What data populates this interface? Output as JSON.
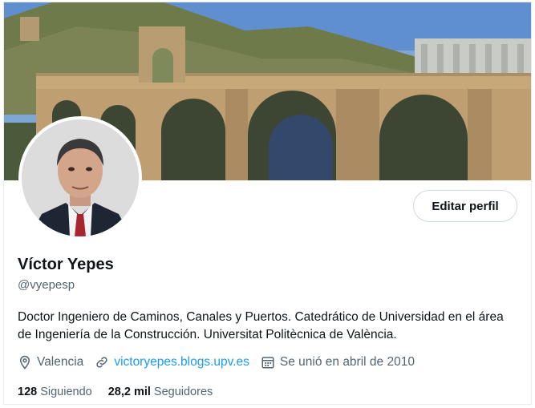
{
  "profile": {
    "name": "Víctor Yepes",
    "handle": "@vyepesp",
    "bio": "Doctor Ingeniero de Caminos, Canales y Puertos. Catedrático de Universidad en el área de Ingeniería de la Construcción. Universitat Politècnica de València.",
    "location": "Valencia",
    "website": "victoryepes.blogs.upv.es",
    "joined": "Se unió en abril de 2010",
    "following_count": "128",
    "following_label": "Siguiendo",
    "followers_count": "28,2 mil",
    "followers_label": "Seguidores"
  },
  "actions": {
    "edit_profile_label": "Editar perfil"
  },
  "icons": {
    "location": "location-pin-icon",
    "website": "link-icon",
    "joined": "calendar-icon"
  },
  "colors": {
    "link": "#1d9bf0",
    "secondary_text": "#536471",
    "primary_text": "#0f1419"
  }
}
